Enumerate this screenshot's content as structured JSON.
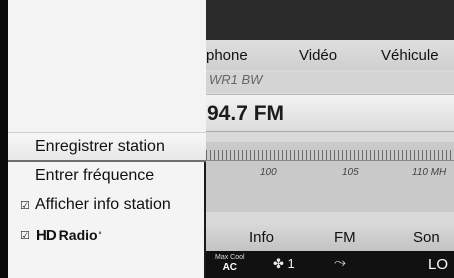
{
  "menu": {
    "items": [
      {
        "label": "Enregistrer station",
        "selected": true,
        "checked": false
      },
      {
        "label": "Entrer fréquence",
        "selected": false,
        "checked": false
      },
      {
        "label": "Afficher info station",
        "selected": false,
        "checked": true
      },
      {
        "label": "Radio",
        "selected": false,
        "checked": true,
        "logo": "HD"
      }
    ]
  },
  "top_tabs": [
    "phone",
    "Vidéo",
    "Véhicule"
  ],
  "station_name": "WR1 BW",
  "frequency": "94.7 FM",
  "scale_labels": [
    "100",
    "105",
    "110 MH"
  ],
  "bottom_menu": [
    "Info",
    "FM",
    "Son"
  ],
  "climate": {
    "maxcool_top": "Max Cool",
    "maxcool_bottom": "AC",
    "fan_icon": "fan-icon",
    "fan_level": "1",
    "airflow_icon": "seat-airflow-icon",
    "temperature": "LO"
  }
}
